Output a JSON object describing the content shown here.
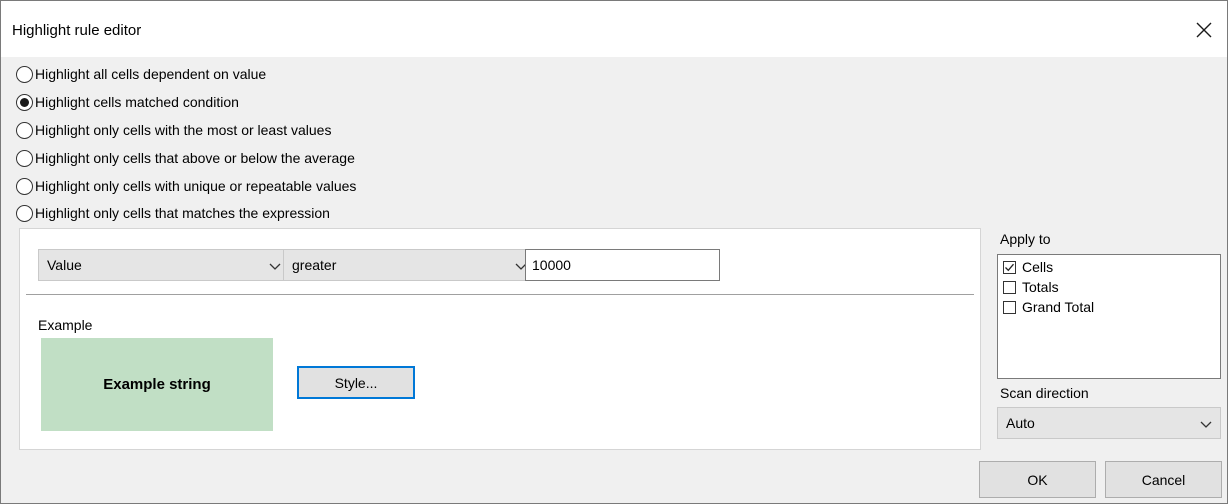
{
  "window": {
    "title": "Highlight rule editor",
    "close_icon": "close-icon"
  },
  "modes": [
    {
      "label": "Highlight all cells dependent on value",
      "checked": false
    },
    {
      "label": "Highlight cells matched condition",
      "checked": true
    },
    {
      "label": "Highlight only cells with the most or least values",
      "checked": false
    },
    {
      "label": "Highlight only cells that above or below the average",
      "checked": false
    },
    {
      "label": "Highlight only cells with unique or repeatable values",
      "checked": false
    },
    {
      "label": "Highlight only cells that matches the expression",
      "checked": false
    }
  ],
  "condition": {
    "field": "Value",
    "operator": "greater",
    "value": "10000"
  },
  "example": {
    "label": "Example",
    "text": "Example string",
    "background": "#c1dfc5",
    "style_button": "Style..."
  },
  "apply_to": {
    "label": "Apply to",
    "items": [
      {
        "label": "Cells",
        "checked": true
      },
      {
        "label": "Totals",
        "checked": false
      },
      {
        "label": "Grand Total",
        "checked": false
      }
    ]
  },
  "scan_direction": {
    "label": "Scan direction",
    "value": "Auto"
  },
  "buttons": {
    "ok": "OK",
    "cancel": "Cancel"
  },
  "colors": {
    "focus_border": "#0078d7",
    "dialog_bg": "#f0f0f0"
  }
}
